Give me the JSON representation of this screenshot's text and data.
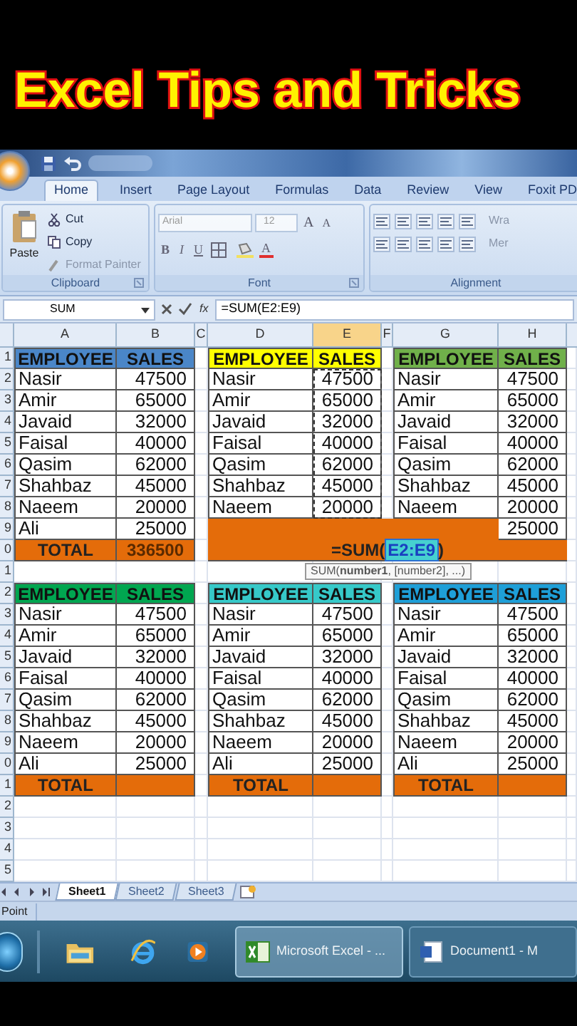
{
  "banner": {
    "title": "Excel Tips and Tricks"
  },
  "ribbon_tabs": [
    {
      "label": "Home",
      "selected": true
    },
    {
      "label": "Insert",
      "selected": false
    },
    {
      "label": "Page Layout",
      "selected": false
    },
    {
      "label": "Formulas",
      "selected": false
    },
    {
      "label": "Data",
      "selected": false
    },
    {
      "label": "Review",
      "selected": false
    },
    {
      "label": "View",
      "selected": false
    },
    {
      "label": "Foxit PD",
      "selected": false
    }
  ],
  "clipboard_group": {
    "paste": "Paste",
    "cut": "Cut",
    "copy": "Copy",
    "format_painter": "Format Painter",
    "label": "Clipboard"
  },
  "font_group": {
    "font_name": "Arial",
    "font_size": "12",
    "grow_font": "A",
    "shrink_font": "A",
    "bold": "B",
    "italic": "I",
    "underline": "U",
    "font_color": "A",
    "label": "Font"
  },
  "alignment_group": {
    "wrap_text": "Wra",
    "merge": "Mer",
    "label": "Alignment"
  },
  "formula_bar": {
    "name_box": "SUM",
    "fx": "fx",
    "formula": "=SUM(E2:E9)"
  },
  "column_headers": [
    {
      "label": "A",
      "selected": false
    },
    {
      "label": "B",
      "selected": false
    },
    {
      "label": "C",
      "selected": false
    },
    {
      "label": "D",
      "selected": false
    },
    {
      "label": "E",
      "selected": true
    },
    {
      "label": "F",
      "selected": false
    },
    {
      "label": "G",
      "selected": false
    },
    {
      "label": "H",
      "selected": false
    }
  ],
  "row_numbers": [
    "1",
    "2",
    "3",
    "4",
    "5",
    "6",
    "7",
    "8",
    "9",
    "0",
    "1",
    "2",
    "3",
    "4",
    "5",
    "6",
    "7",
    "8",
    "9",
    "0",
    "1",
    "2",
    "3",
    "4",
    "5"
  ],
  "tables": [
    {
      "color": "#4a86c8",
      "headers": [
        "EMPLOYEE",
        "SALES"
      ],
      "rows": [
        {
          "name": "Nasir",
          "sales": "47500"
        },
        {
          "name": "Amir",
          "sales": "65000"
        },
        {
          "name": "Javaid",
          "sales": "32000"
        },
        {
          "name": "Faisal",
          "sales": "40000"
        },
        {
          "name": "Qasim",
          "sales": "62000"
        },
        {
          "name": "Shahbaz",
          "sales": "45000"
        },
        {
          "name": "Naeem",
          "sales": "20000"
        },
        {
          "name": "Ali",
          "sales": "25000"
        }
      ],
      "total": {
        "label": "TOTAL",
        "value": "336500"
      }
    },
    {
      "color": "#ffff00",
      "headers": [
        "EMPLOYEE",
        "SALES"
      ],
      "rows": [
        {
          "name": "Nasir",
          "sales": "47500"
        },
        {
          "name": "Amir",
          "sales": "65000"
        },
        {
          "name": "Javaid",
          "sales": "32000"
        },
        {
          "name": "Faisal",
          "sales": "40000"
        },
        {
          "name": "Qasim",
          "sales": "62000"
        },
        {
          "name": "Shahbaz",
          "sales": "45000"
        },
        {
          "name": "Naeem",
          "sales": "20000"
        }
      ]
    },
    {
      "color": "#70b04a",
      "headers": [
        "EMPLOYEE",
        "SALES"
      ],
      "rows": [
        {
          "name": "Nasir",
          "sales": "47500"
        },
        {
          "name": "Amir",
          "sales": "65000"
        },
        {
          "name": "Javaid",
          "sales": "32000"
        },
        {
          "name": "Faisal",
          "sales": "40000"
        },
        {
          "name": "Qasim",
          "sales": "62000"
        },
        {
          "name": "Shahbaz",
          "sales": "45000"
        },
        {
          "name": "Naeem",
          "sales": "20000"
        },
        {
          "sales": "25000"
        }
      ]
    },
    {
      "color": "#00a650",
      "headers": [
        "EMPLOYEE",
        "SALES"
      ],
      "rows": [
        {
          "name": "Nasir",
          "sales": "47500"
        },
        {
          "name": "Amir",
          "sales": "65000"
        },
        {
          "name": "Javaid",
          "sales": "32000"
        },
        {
          "name": "Faisal",
          "sales": "40000"
        },
        {
          "name": "Qasim",
          "sales": "62000"
        },
        {
          "name": "Shahbaz",
          "sales": "45000"
        },
        {
          "name": "Naeem",
          "sales": "20000"
        },
        {
          "name": "Ali",
          "sales": "25000"
        }
      ],
      "total": {
        "label": "TOTAL"
      }
    },
    {
      "color": "#36c9c9",
      "headers": [
        "EMPLOYEE",
        "SALES"
      ],
      "rows": [
        {
          "name": "Nasir",
          "sales": "47500"
        },
        {
          "name": "Amir",
          "sales": "65000"
        },
        {
          "name": "Javaid",
          "sales": "32000"
        },
        {
          "name": "Faisal",
          "sales": "40000"
        },
        {
          "name": "Qasim",
          "sales": "62000"
        },
        {
          "name": "Shahbaz",
          "sales": "45000"
        },
        {
          "name": "Naeem",
          "sales": "20000"
        },
        {
          "name": "Ali",
          "sales": "25000"
        }
      ],
      "total": {
        "label": "TOTAL"
      }
    },
    {
      "color": "#1e9fd8",
      "headers": [
        "EMPLOYEE",
        "SALES"
      ],
      "rows": [
        {
          "name": "Nasir",
          "sales": "47500"
        },
        {
          "name": "Amir",
          "sales": "65000"
        },
        {
          "name": "Javaid",
          "sales": "32000"
        },
        {
          "name": "Faisal",
          "sales": "40000"
        },
        {
          "name": "Qasim",
          "sales": "62000"
        },
        {
          "name": "Shahbaz",
          "sales": "45000"
        },
        {
          "name": "Naeem",
          "sales": "20000"
        },
        {
          "name": "Ali",
          "sales": "25000"
        }
      ],
      "total": {
        "label": "TOTAL"
      }
    }
  ],
  "formula_cell": {
    "prefix": "=SUM(",
    "reference": "E2:E9",
    "suffix": ")"
  },
  "tooltip": "SUM(**number1**, [number2], ...)",
  "sheet_tabs": [
    {
      "label": "Sheet1",
      "selected": true
    },
    {
      "label": "Sheet2",
      "selected": false
    },
    {
      "label": "Sheet3",
      "selected": false
    }
  ],
  "status_bar": {
    "mode": "Point"
  },
  "taskbar": {
    "windows": [
      {
        "label": "Microsoft Excel - ...",
        "selected": true
      },
      {
        "label": "Document1 - M",
        "selected": false
      }
    ]
  }
}
